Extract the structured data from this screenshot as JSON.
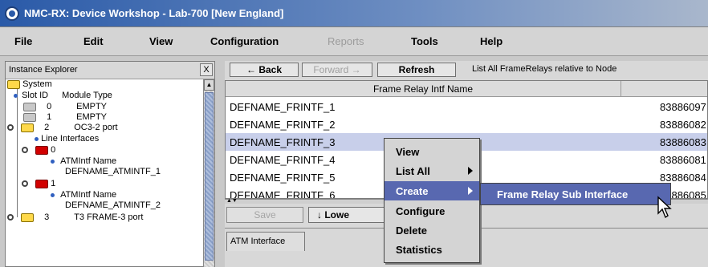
{
  "window": {
    "title": "NMC-RX: Device Workshop - Lab-700 [New England]"
  },
  "menubar": {
    "items": [
      {
        "label": "File",
        "enabled": true
      },
      {
        "label": "Edit",
        "enabled": true
      },
      {
        "label": "View",
        "enabled": true
      },
      {
        "label": "Configuration",
        "enabled": true
      },
      {
        "label": "Reports",
        "enabled": false
      },
      {
        "label": "Tools",
        "enabled": true
      },
      {
        "label": "Help",
        "enabled": true
      }
    ]
  },
  "explorer": {
    "title": "Instance Explorer",
    "close_label": "X",
    "tree": {
      "system": "System",
      "slot_id": "Slot ID",
      "module_type": "Module Type",
      "slots": [
        {
          "id": "0",
          "type": "EMPTY"
        },
        {
          "id": "1",
          "type": "EMPTY"
        },
        {
          "id": "2",
          "type": "OC3-2 port"
        },
        {
          "id": "3",
          "type": "T3 FRAME-3 port"
        }
      ],
      "line_interfaces": "Line Interfaces",
      "ifaces": [
        {
          "id": "0",
          "atm_label": "ATMIntf Name",
          "atm_value": "DEFNAME_ATMINTF_1"
        },
        {
          "id": "1",
          "atm_label": "ATMIntf Name",
          "atm_value": "DEFNAME_ATMINTF_2"
        }
      ]
    }
  },
  "toolbar": {
    "back": "← Back",
    "forward": "Forward →",
    "refresh": "Refresh",
    "caption": "List All FrameRelays relative to Node"
  },
  "table": {
    "header": "Frame Relay Intf Name",
    "rows": [
      {
        "name": "DEFNAME_FRINTF_1",
        "id": "83886097",
        "selected": false
      },
      {
        "name": "DEFNAME_FRINTF_2",
        "id": "83886082",
        "selected": false
      },
      {
        "name": "DEFNAME_FRINTF_3",
        "id": "83886083",
        "selected": true
      },
      {
        "name": "DEFNAME_FRINTF_4",
        "id": "83886081",
        "selected": false
      },
      {
        "name": "DEFNAME_FRINTF_5",
        "id": "83886084",
        "selected": false
      },
      {
        "name": "DEFNAME_FRINTF_6",
        "id": "83886085",
        "selected": false
      }
    ]
  },
  "bottom": {
    "save": "Save",
    "lower": "↓ Lowe",
    "tab": "ATM Interface"
  },
  "context_menu": {
    "items": [
      {
        "label": "View",
        "submenu": false
      },
      {
        "label": "List All",
        "submenu": true
      },
      {
        "label": "Create",
        "submenu": true,
        "active": true
      },
      {
        "label": "Configure",
        "submenu": false
      },
      {
        "label": "Delete",
        "submenu": false
      },
      {
        "label": "Statistics",
        "submenu": false
      }
    ],
    "submenu_label": "Frame Relay Sub Interface"
  },
  "colors": {
    "selection": "#c8cfea",
    "menu_highlight": "#5868b0",
    "folder_yellow": "#ffd94a",
    "folder_red": "#d10000"
  }
}
